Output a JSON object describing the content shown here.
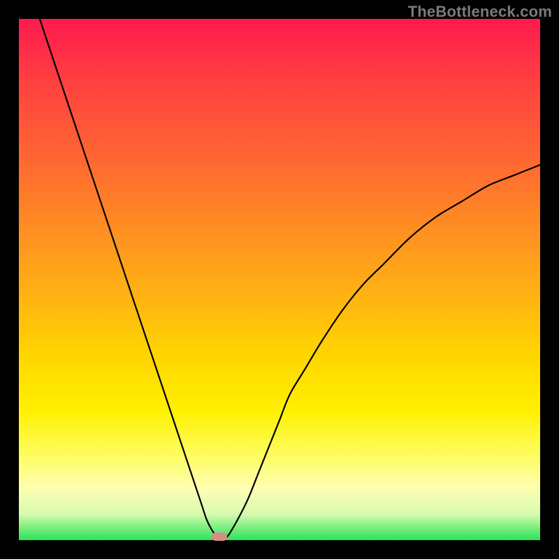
{
  "watermark": "TheBottleneck.com",
  "chart_data": {
    "type": "line",
    "title": "",
    "xlabel": "",
    "ylabel": "",
    "xlim": [
      0,
      100
    ],
    "ylim": [
      0,
      100
    ],
    "series": [
      {
        "name": "curve",
        "x": [
          4,
          6,
          8,
          10,
          12,
          14,
          16,
          18,
          20,
          22,
          24,
          26,
          28,
          30,
          32,
          34,
          35,
          36,
          37,
          38,
          39,
          40,
          42,
          44,
          46,
          48,
          50,
          52,
          55,
          58,
          62,
          66,
          70,
          75,
          80,
          85,
          90,
          95,
          100
        ],
        "values": [
          100,
          94,
          88,
          82,
          76,
          70,
          64,
          58,
          52,
          46,
          40,
          34,
          28,
          22,
          16,
          10,
          7,
          4,
          2,
          0.7,
          0.7,
          0.7,
          4,
          8,
          13,
          18,
          23,
          28,
          33,
          38,
          44,
          49,
          53,
          58,
          62,
          65,
          68,
          70,
          72
        ]
      }
    ],
    "marker": {
      "x": 38.5,
      "y": 0.7
    },
    "background_gradient": {
      "stops": [
        {
          "pos": 0,
          "color": "#ff1a4d"
        },
        {
          "pos": 0.55,
          "color": "#ffb810"
        },
        {
          "pos": 0.85,
          "color": "#fdfd63"
        },
        {
          "pos": 1.0,
          "color": "#28e45e"
        }
      ]
    }
  }
}
